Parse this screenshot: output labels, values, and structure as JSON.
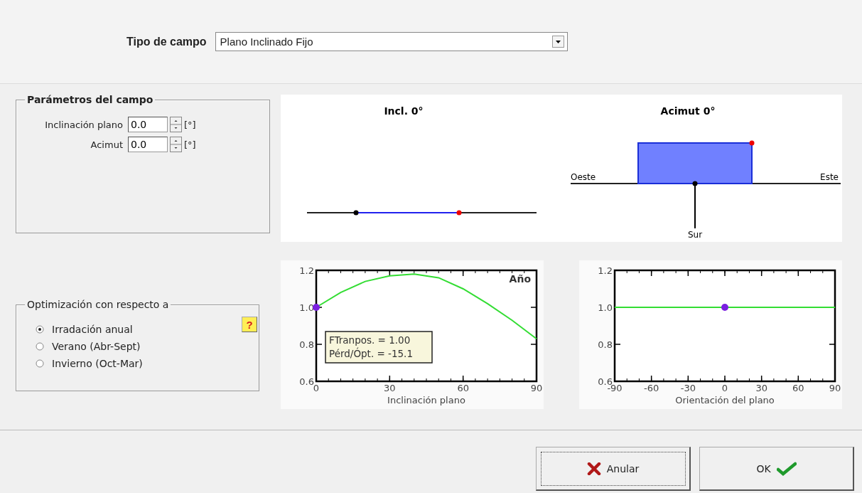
{
  "field_type": {
    "label": "Tipo de campo",
    "value": "Plano Inclinado Fijo"
  },
  "parameters": {
    "title": "Parámetros del campo",
    "fields": [
      {
        "label": "Inclinación plano",
        "value": "0.0",
        "unit": "[°]"
      },
      {
        "label": "Acimut",
        "value": "0.0",
        "unit": "[°]"
      }
    ]
  },
  "diagram": {
    "tilt_title": "Incl. 0°",
    "azimuth_title": "Acimut 0°",
    "west": "Oeste",
    "east": "Este",
    "south": "Sur"
  },
  "optimization": {
    "title": "Optimización con respecto a",
    "help": "?",
    "options": [
      {
        "label": "Irradación anual",
        "selected": true
      },
      {
        "label": "Verano (Abr-Sept)",
        "selected": false
      },
      {
        "label": "Invierno (Oct-Mar)",
        "selected": false
      }
    ]
  },
  "charts": [
    {
      "info_box": [
        "FTranpos. = 1.00",
        "Pérd/Ópt. = -15.1"
      ],
      "chart_data": {
        "type": "line",
        "xlabel": "Inclinación plano",
        "x": [
          0,
          10,
          20,
          30,
          40,
          50,
          60,
          70,
          80,
          90
        ],
        "series": [
          {
            "name": "Año",
            "color": "#33dd33",
            "values": [
              1.0,
              1.08,
              1.14,
              1.17,
              1.18,
              1.16,
              1.1,
              1.02,
              0.93,
              0.83
            ]
          }
        ],
        "xlim": [
          0,
          90
        ],
        "ylim": [
          0.6,
          1.2
        ],
        "xticks": [
          0,
          30,
          60,
          90
        ],
        "yticks": [
          {
            "value": 0.6,
            "label": "0.6"
          },
          {
            "value": 0.8,
            "label": "0.8"
          },
          {
            "value": 1,
            "label": "1.0"
          },
          {
            "value": 1.2,
            "label": "1.2"
          }
        ]
      }
    },
    {
      "chart_data": {
        "type": "line",
        "xlabel": "Orientación del plano",
        "x": [
          -90,
          90
        ],
        "series": [
          {
            "color": "#33dd33",
            "values": [
              1.0,
              1.0
            ]
          }
        ],
        "xlim": [
          -90,
          90
        ],
        "ylim": [
          0.6,
          1.2
        ],
        "xticks": [
          -90,
          -60,
          -30,
          0,
          30,
          60,
          90
        ],
        "yticks": [
          {
            "value": 0.6,
            "label": "0.6"
          },
          {
            "value": 0.8,
            "label": "0.8"
          },
          {
            "value": 1,
            "label": "1.0"
          },
          {
            "value": 1.2,
            "label": "1.2"
          }
        ]
      }
    }
  ],
  "buttons": [
    {
      "kind": "cancel",
      "label": "Anular"
    },
    {
      "kind": "ok",
      "label": "OK"
    }
  ]
}
